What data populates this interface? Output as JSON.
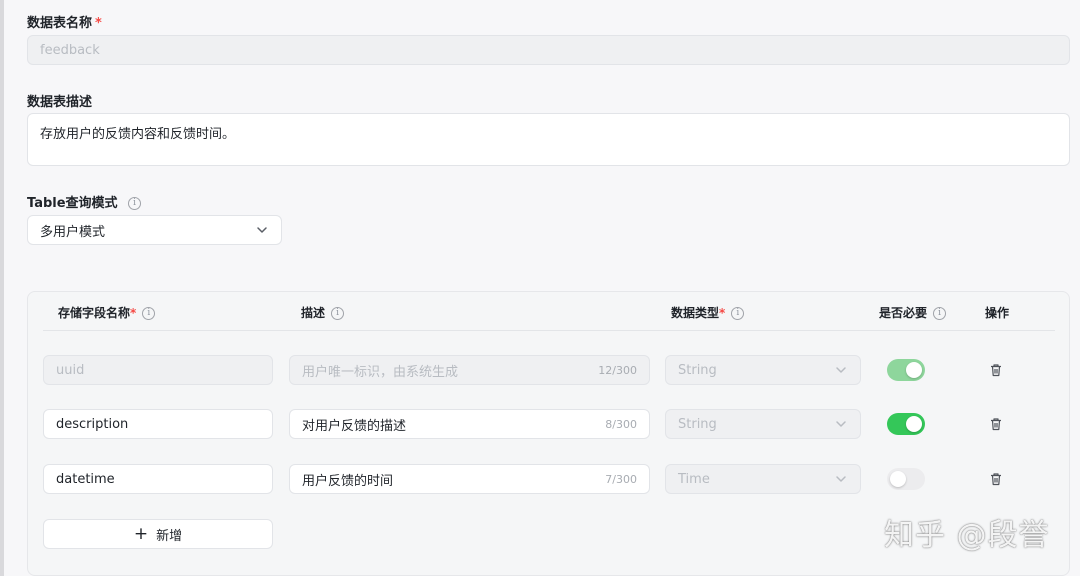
{
  "form": {
    "table_name": {
      "label": "数据表名称",
      "required_mark": "*",
      "value": "feedback"
    },
    "table_desc": {
      "label": "数据表描述",
      "value": "存放用户的反馈内容和反馈时间。"
    },
    "query_mode": {
      "label": "Table查询模式",
      "info_icon": "i",
      "selected": "多用户模式"
    }
  },
  "fields_table": {
    "headers": {
      "name": "存储字段名称",
      "name_required": "*",
      "desc": "描述",
      "type": "数据类型",
      "type_required": "*",
      "required": "是否必要",
      "action": "操作",
      "info_icon": "i"
    },
    "rows": [
      {
        "name": "uuid",
        "desc": "用户唯一标识，由系统生成",
        "count": "12/300",
        "type": "String",
        "required_on": true,
        "disabled": true
      },
      {
        "name": "description",
        "desc": "对用户反馈的描述",
        "count": "8/300",
        "type": "String",
        "required_on": true,
        "disabled": false
      },
      {
        "name": "datetime",
        "desc": "用户反馈的时间",
        "count": "7/300",
        "type": "Time",
        "required_on": false,
        "disabled": false
      }
    ],
    "add_button": {
      "icon": "+",
      "label": "新增"
    }
  },
  "colors": {
    "toggle_on": "#34c759",
    "toggle_on_disabled": "#8ed69c",
    "toggle_off": "#ececee",
    "required_mark": "#f54a45"
  },
  "watermark": "知乎 @段誉"
}
